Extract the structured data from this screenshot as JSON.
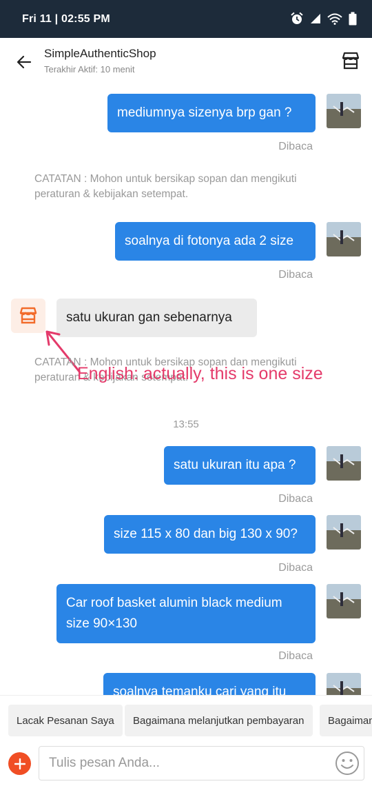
{
  "status_bar": {
    "time": "Fri 11 | 02:55 PM",
    "icons": [
      "alarm-icon",
      "signal-icon",
      "wifi-icon",
      "battery-icon"
    ]
  },
  "header": {
    "shop_name": "SimpleAuthenticShop",
    "last_active": "Terakhir Aktif: 10 menit",
    "back_icon": "back-arrow-icon",
    "store_icon": "store-icon"
  },
  "messages": {
    "m1": {
      "text": "mediumnya sizenya brp gan ?",
      "status": "Dibaca"
    },
    "note1": "CATATAN : Mohon untuk bersikap sopan dan mengikuti peraturan & kebijakan setempat.",
    "m2": {
      "text": "soalnya di fotonya ada 2 size",
      "status": "Dibaca"
    },
    "m3": {
      "text": "satu ukuran gan sebenarnya"
    },
    "note2": "CATATAN : Mohon untuk bersikap sopan dan mengikuti peraturan & kebijakan setempat.",
    "time_sep": "13:55",
    "m4": {
      "text": "satu ukuran itu apa ?",
      "status": "Dibaca"
    },
    "m5": {
      "text": "size 115 x 80 dan big 130 x 90?",
      "status": "Dibaca"
    },
    "m6": {
      "text": "Car roof basket alumin black medium size 90×130",
      "status": "Dibaca"
    },
    "m7": {
      "text": "soalnya temanku cari yang itu"
    }
  },
  "annotation": "English: actually, this is one size",
  "quick_replies": [
    "Lacak Pesanan Saya",
    "Bagaimana melanjutkan pembayaran",
    "Bagaiman"
  ],
  "input": {
    "placeholder": "Tulis pesan Anda...",
    "value": ""
  },
  "colors": {
    "status_bar": "#1d2b3a",
    "bubble_out": "#2a85e6",
    "bubble_in": "#ebebeb",
    "accent_orange": "#f04e24",
    "annotation": "#e43a6a"
  }
}
